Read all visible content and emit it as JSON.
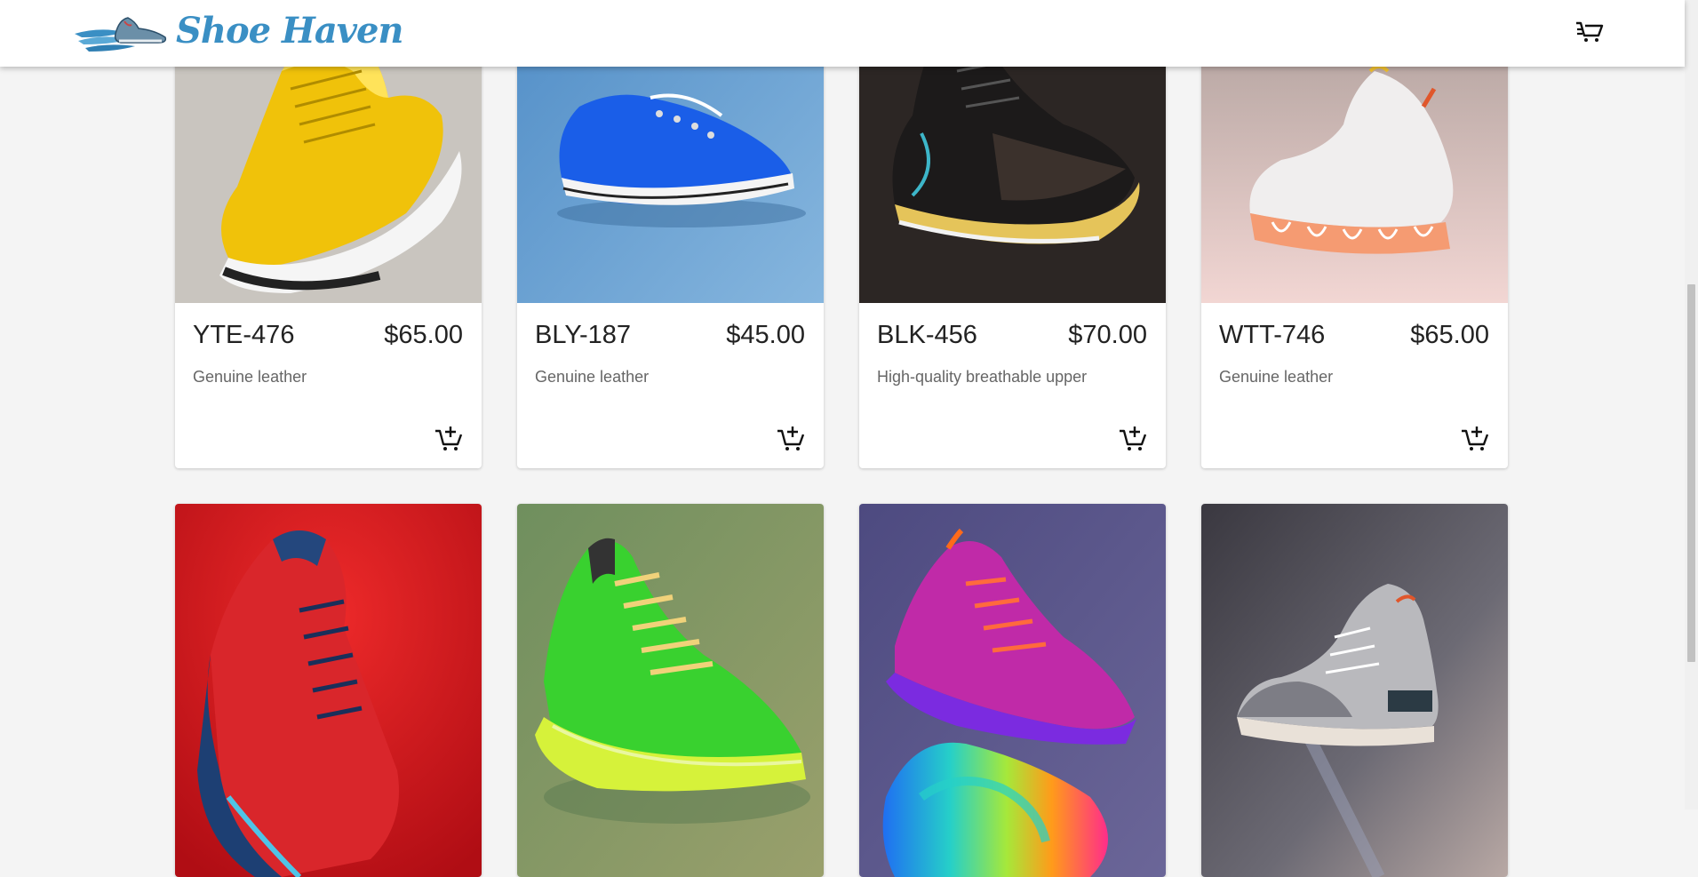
{
  "brand": {
    "logo_text": "Shoe Haven",
    "logo_icon": "winged-shoe-icon",
    "accent": "#3a8fc4"
  },
  "header": {
    "cart_icon": "cart-icon"
  },
  "products": [
    {
      "name": "YTE-476",
      "price": "$65.00",
      "description": "Genuine leather",
      "color": "yellow",
      "add_icon": "add-to-cart-icon"
    },
    {
      "name": "BLY-187",
      "price": "$45.00",
      "description": "Genuine leather",
      "color": "blue",
      "add_icon": "add-to-cart-icon"
    },
    {
      "name": "BLK-456",
      "price": "$70.00",
      "description": "High-quality breathable upper",
      "color": "black",
      "add_icon": "add-to-cart-icon"
    },
    {
      "name": "WTT-746",
      "price": "$65.00",
      "description": "Genuine leather",
      "color": "white",
      "add_icon": "add-to-cart-icon"
    },
    {
      "color": "red"
    },
    {
      "color": "green"
    },
    {
      "color": "purple"
    },
    {
      "color": "grey"
    }
  ]
}
